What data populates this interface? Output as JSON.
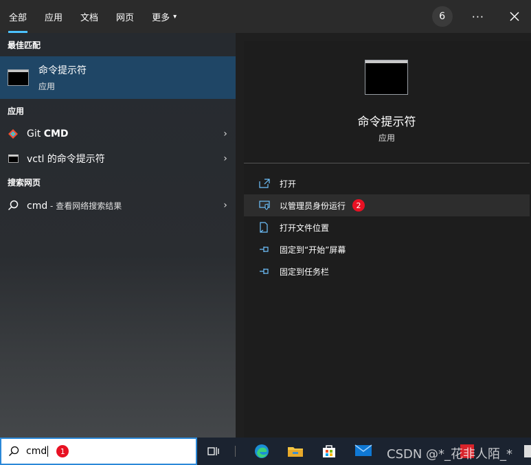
{
  "tabs": [
    {
      "label": "全部",
      "active": true
    },
    {
      "label": "应用"
    },
    {
      "label": "文档"
    },
    {
      "label": "网页"
    },
    {
      "label": "更多"
    }
  ],
  "more_caret": "▾",
  "top_right": {
    "points_badge": "6",
    "more_options": "···",
    "close": "✕"
  },
  "left": {
    "best_match_header": "最佳匹配",
    "best_match": {
      "title": "命令提示符",
      "subtitle": "应用",
      "icon": "cmd-icon"
    },
    "apps_header": "应用",
    "apps": [
      {
        "prefix": "Git ",
        "bold": "CMD",
        "icon": "git-icon"
      },
      {
        "prefix": "vctl 的命令提示符",
        "bold": "",
        "icon": "cmd-icon"
      }
    ],
    "web_header": "搜索网页",
    "web": {
      "term": "cmd",
      "sub": " - 查看网络搜索结果",
      "icon": "search-icon"
    },
    "chevron": "›"
  },
  "right": {
    "title": "命令提示符",
    "subtitle": "应用",
    "actions": [
      {
        "label": "打开",
        "icon": "open-icon"
      },
      {
        "label": "以管理员身份运行",
        "icon": "shield-icon",
        "badge": "2",
        "highlighted": true
      },
      {
        "label": "打开文件位置",
        "icon": "file-location-icon"
      },
      {
        "label": "固定到“开始”屏幕",
        "icon": "pin-icon"
      },
      {
        "label": "固定到任务栏",
        "icon": "pin-icon"
      }
    ]
  },
  "taskbar": {
    "search_value": "cmd",
    "search_badge": "1",
    "watermark": "CSDN @*_花非人陌_*"
  },
  "colors": {
    "accent": "#4cc2ff",
    "highlight_bg": "#1f4666",
    "badge_red": "#e81123"
  }
}
